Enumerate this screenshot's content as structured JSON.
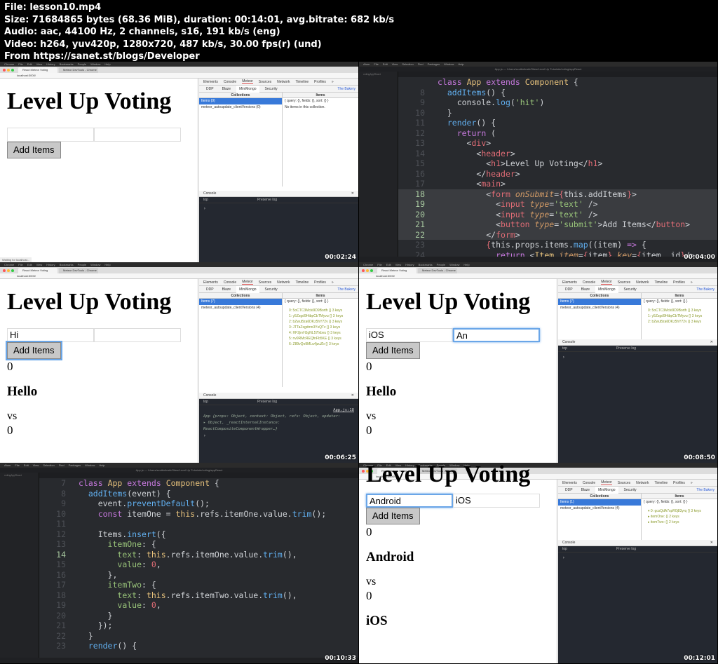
{
  "file_info": {
    "lines": [
      "File: lesson10.mp4",
      "Size: 71684865 bytes (68.36 MiB), duration: 00:14:01, avg.bitrate: 682 kb/s",
      "Audio: aac, 44100 Hz, 2 channels, s16, 191 kb/s (eng)",
      "Video: h264, yuv420p, 1280x720, 487 kb/s, 30.00 fps(r) (und)",
      "From https://sanet.st/blogs/Developer"
    ]
  },
  "mac_menu": {
    "chrome": [
      "",
      "Chrome",
      "File",
      "Edit",
      "View",
      "History",
      "Bookmarks",
      "People",
      "Window",
      "Help"
    ],
    "atom": [
      "",
      "Atom",
      "File",
      "Edit",
      "View",
      "Selection",
      "Find",
      "Packages",
      "Window",
      "Help"
    ]
  },
  "browser": {
    "tab_active": "React Meteor Voting",
    "tab_inactive": "Meteor DevTools - Chrome",
    "address": "localhost:3000/"
  },
  "app": {
    "title": "Level Up Voting",
    "button_label": "Add Items",
    "vs": "vs"
  },
  "devtools": {
    "tabs": [
      "Elements",
      "Console",
      "Meteor",
      "Sources",
      "Network",
      "Timeline",
      "Profiles",
      "»"
    ],
    "subtabs": [
      "DDP",
      "Blaze",
      "MiniMongo",
      "Security"
    ],
    "bakery": "The Bakery",
    "collections_header": "Collections",
    "items_header": "Items",
    "query": "{ query: {}, fields: {}, sort: {} }",
    "empty_message": "No items in this collection.",
    "console_label": "Console",
    "console_filter": "top",
    "preserve_log": "Preserve log"
  },
  "frames": [
    {
      "timestamp": "00:02:24",
      "input_one": "",
      "input_two": "",
      "collections": [
        "Items (0)",
        "meteor_autoupdate_clientVersions (0)"
      ],
      "status_text": "Waiting for localhost..."
    },
    {
      "timestamp": "00:04:00",
      "file_title": "App.js — /Users/scotttolinski/Sites/Level Up Tutorials/voting/appReact",
      "project": "votingAppReact",
      "code_lines": [
        {
          "n": "",
          "html": "<span class='kw'>class</span> <span class='cl'>App</span> <span class='kw'>extends</span> <span class='cl'>Component</span> {"
        },
        {
          "n": "8",
          "html": "  <span class='fn'>addItems</span>() {"
        },
        {
          "n": "9",
          "html": "    console.<span class='fn'>log</span>(<span class='st'>'hit'</span>)"
        },
        {
          "n": "10",
          "html": "  }"
        },
        {
          "n": "11",
          "html": "  <span class='fn'>render</span>() {"
        },
        {
          "n": "12",
          "html": "    <span class='kw'>return</span> ("
        },
        {
          "n": "13",
          "html": "      &lt;<span class='tg'>div</span>&gt;"
        },
        {
          "n": "14",
          "html": "        &lt;<span class='tg'>header</span>&gt;"
        },
        {
          "n": "15",
          "html": "          &lt;<span class='tg'>h1</span>&gt;Level Up Voting&lt;/<span class='tg'>h1</span>&gt;"
        },
        {
          "n": "16",
          "html": "        &lt;/<span class='tg'>header</span>&gt;"
        },
        {
          "n": "17",
          "html": "        &lt;<span class='tg'>main</span>&gt;"
        },
        {
          "n": "18",
          "html": "          &lt;<span class='tg'>form</span> <span class='at'>onSubmit</span>=<span class='tg'>{</span>this.addItems<span class='tg'>}</span>&gt;",
          "hl": true
        },
        {
          "n": "19",
          "html": "            &lt;<span class='tg'>input</span> <span class='at'>type</span>=<span class='st'>'text'</span> /&gt;",
          "hl": true
        },
        {
          "n": "20",
          "html": "            &lt;<span class='tg'>input</span> <span class='at'>type</span>=<span class='st'>'text'</span> /&gt;",
          "hl": true
        },
        {
          "n": "21",
          "html": "            &lt;<span class='tg'>button</span> <span class='at'>type</span>=<span class='st'>'submit'</span>&gt;Add Items&lt;/<span class='tg'>button</span>&gt;",
          "hl": true
        },
        {
          "n": "22",
          "html": "          &lt;/<span class='tg'>form</span>&gt;",
          "hl": true
        },
        {
          "n": "23",
          "html": "          <span class='tg'>{</span>this.props.items.<span class='fn'>map</span>((item) <span class='kw'>=&gt;</span> {"
        },
        {
          "n": "24",
          "html": "            <span class='kw'>return</span> &lt;<span class='cl'>Item</span> <span class='at'>item</span>=<span class='tg'>{</span>item<span class='tg'>}</span> <span class='at'>key</span>=<span class='tg'>{</span>item._id<span class='tg'>}</span>/&gt;"
        }
      ]
    },
    {
      "timestamp": "00:06:25",
      "input_one": "Hi",
      "input_two": "",
      "count_one": "0",
      "item_one": "Hello",
      "count_two": "0",
      "collections": [
        "Items (7)",
        "meteor_autoupdate_clientVersions (4)"
      ],
      "tree": [
        "0: 5oCTC3Mcki9D9Borth  {}  3 keys",
        "1: y5Zzgd9HtbpCbTMyvu  {}  3 keys",
        "2: bZwuBza6DKz5hY72v  {}  3 keys",
        "3: JTTaZsgdmn3YsQTv  {}  3 keys",
        "4: HF2jrvHJgNL57fxbvu  {}  3 keys",
        "5: nv9RMcREQfnFb5KE  {}  3 keys",
        "6: Z89vQo9MLu4jzuZb  {}  3 keys"
      ],
      "console_link": "App.js:18",
      "console_lines": [
        "App {props: Object, context: Object, refs: Object, updater:",
        "▸ Object, _reactInternalInstance:",
        "ReactCompositeComponentWrapper…}"
      ]
    },
    {
      "timestamp": "00:08:50",
      "input_one": "iOS",
      "input_two": "An",
      "count_one": "0",
      "item_one": "Hello",
      "count_two": "0",
      "collections": [
        "Items (7)",
        "meteor_autoupdate_clientVersions (4)"
      ],
      "tree": [
        "0: 5oCTC3Mcki9D9Borth  {}  3 keys",
        "1: y5Zzgd9HtbpCbTMyvu  {}  3 keys",
        "2: bZwuBza6DKz5hY72v  {}  3 keys"
      ]
    },
    {
      "timestamp": "00:10:33",
      "file_title": "App.js — /Users/scotttolinski/Sites/Level Up Tutorials/voting/appReact",
      "project": "votingAppReact",
      "code_lines": [
        {
          "n": "7",
          "html": "<span class='kw'>class</span> <span class='cl'>App</span> <span class='kw'>extends</span> <span class='cl'>Component</span> {"
        },
        {
          "n": "8",
          "html": "  <span class='fn'>addItems</span>(event) {"
        },
        {
          "n": "9",
          "html": "    event.<span class='fn'>preventDefault</span>();"
        },
        {
          "n": "10",
          "html": "    <span class='kw'>const</span> itemOne = <span class='cl'>this</span>.refs.itemOne.value.<span class='fn'>trim</span>();"
        },
        {
          "n": "11",
          "html": ""
        },
        {
          "n": "12",
          "html": "    Items.<span class='fn'>insert</span>({"
        },
        {
          "n": "13",
          "html": "      <span class='ob'>itemOne</span>: {"
        },
        {
          "n": "14",
          "html": "        <span class='ob'>text</span>: <span class='cl'>this</span>.refs.itemOne.value.<span class='fn'>trim</span>(),",
          "cur": true
        },
        {
          "n": "15",
          "html": "        <span class='ob'>value</span>: <span class='nm'>0</span>,"
        },
        {
          "n": "16",
          "html": "      },"
        },
        {
          "n": "17",
          "html": "      <span class='ob'>itemTwo</span>: {"
        },
        {
          "n": "18",
          "html": "        <span class='ob'>text</span>: <span class='cl'>this</span>.refs.itemTwo.value.<span class='fn'>trim</span>(),"
        },
        {
          "n": "19",
          "html": "        <span class='ob'>value</span>: <span class='nm'>0</span>,"
        },
        {
          "n": "20",
          "html": "      }"
        },
        {
          "n": "21",
          "html": "    });"
        },
        {
          "n": "22",
          "html": "  }"
        },
        {
          "n": "23",
          "html": "  <span class='fn'>render</span>() {"
        }
      ]
    },
    {
      "timestamp": "00:12:01",
      "input_one": "Android",
      "input_two": "iOS",
      "count_one": "0",
      "item_one": "Android",
      "vs": "vs",
      "count_two": "0",
      "item_two": "iOS",
      "collections": [
        "Items (1)",
        "meteor_autoupdate_clientVersions (4)"
      ],
      "tree": [
        "▾ 0: gcsQdA7xpR0j83yrq  {}  3 keys",
        "  ▸ itemOne:  {}  2 keys",
        "  ▸ itemTwo:  {}  2 keys"
      ]
    }
  ]
}
